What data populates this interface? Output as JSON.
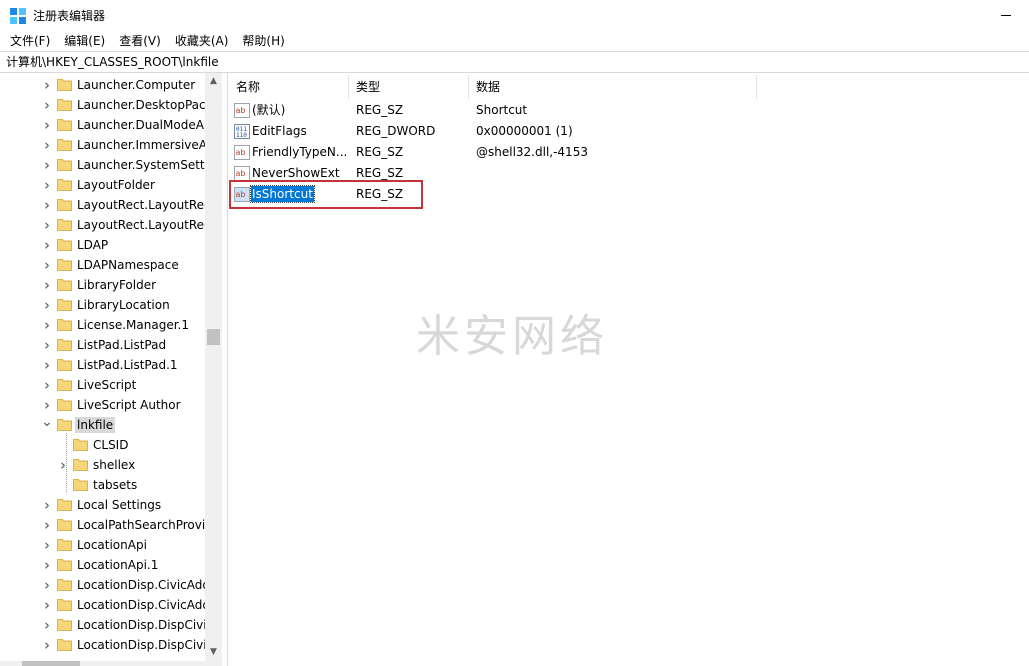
{
  "window": {
    "title": "注册表编辑器"
  },
  "menu": [
    "文件(F)",
    "编辑(E)",
    "查看(V)",
    "收藏夹(A)",
    "帮助(H)"
  ],
  "address": "计算机\\HKEY_CLASSES_ROOT\\lnkfile",
  "tree": [
    {
      "label": "Launcher.Computer",
      "level": 1,
      "expand": "collapsed"
    },
    {
      "label": "Launcher.DesktopPack",
      "level": 1,
      "expand": "collapsed"
    },
    {
      "label": "Launcher.DualModeAp",
      "level": 1,
      "expand": "collapsed"
    },
    {
      "label": "Launcher.ImmersiveAp",
      "level": 1,
      "expand": "collapsed"
    },
    {
      "label": "Launcher.SystemSettin",
      "level": 1,
      "expand": "collapsed"
    },
    {
      "label": "LayoutFolder",
      "level": 1,
      "expand": "collapsed"
    },
    {
      "label": "LayoutRect.LayoutRect",
      "level": 1,
      "expand": "collapsed"
    },
    {
      "label": "LayoutRect.LayoutRect",
      "level": 1,
      "expand": "collapsed"
    },
    {
      "label": "LDAP",
      "level": 1,
      "expand": "collapsed"
    },
    {
      "label": "LDAPNamespace",
      "level": 1,
      "expand": "collapsed"
    },
    {
      "label": "LibraryFolder",
      "level": 1,
      "expand": "collapsed"
    },
    {
      "label": "LibraryLocation",
      "level": 1,
      "expand": "collapsed"
    },
    {
      "label": "License.Manager.1",
      "level": 1,
      "expand": "collapsed"
    },
    {
      "label": "ListPad.ListPad",
      "level": 1,
      "expand": "collapsed"
    },
    {
      "label": "ListPad.ListPad.1",
      "level": 1,
      "expand": "collapsed"
    },
    {
      "label": "LiveScript",
      "level": 1,
      "expand": "collapsed"
    },
    {
      "label": "LiveScript Author",
      "level": 1,
      "expand": "collapsed"
    },
    {
      "label": "lnkfile",
      "level": 1,
      "expand": "expanded",
      "selected": true
    },
    {
      "label": "CLSID",
      "level": 2,
      "expand": "none"
    },
    {
      "label": "shellex",
      "level": 2,
      "expand": "collapsed"
    },
    {
      "label": "tabsets",
      "level": 2,
      "expand": "none"
    },
    {
      "label": "Local Settings",
      "level": 1,
      "expand": "collapsed"
    },
    {
      "label": "LocalPathSearchProvic",
      "level": 1,
      "expand": "collapsed"
    },
    {
      "label": "LocationApi",
      "level": 1,
      "expand": "collapsed"
    },
    {
      "label": "LocationApi.1",
      "level": 1,
      "expand": "collapsed"
    },
    {
      "label": "LocationDisp.CivicAdd",
      "level": 1,
      "expand": "collapsed"
    },
    {
      "label": "LocationDisp.CivicAdd",
      "level": 1,
      "expand": "collapsed"
    },
    {
      "label": "LocationDisp.DispCivic",
      "level": 1,
      "expand": "collapsed"
    },
    {
      "label": "LocationDisp.DispCivic",
      "level": 1,
      "expand": "collapsed"
    }
  ],
  "columns": {
    "name": "名称",
    "type": "类型",
    "data": "数据"
  },
  "values": [
    {
      "name": "(默认)",
      "type": "REG_SZ",
      "data": "Shortcut",
      "icon": "string-value-icon"
    },
    {
      "name": "EditFlags",
      "type": "REG_DWORD",
      "data": "0x00000001 (1)",
      "icon": "binary-value-icon"
    },
    {
      "name": "FriendlyTypeN...",
      "type": "REG_SZ",
      "data": "@shell32.dll,-4153",
      "icon": "string-value-icon"
    },
    {
      "name": "NeverShowExt",
      "type": "REG_SZ",
      "data": "",
      "icon": "string-value-icon"
    },
    {
      "name": "IsShortcut",
      "type": "REG_SZ",
      "data": "",
      "icon": "string-value-icon",
      "selected": true
    }
  ],
  "watermark": "米安网络",
  "colors": {
    "selection": "#0078d7",
    "highlight_box": "#c4333a",
    "folder": "#f5d77a"
  }
}
